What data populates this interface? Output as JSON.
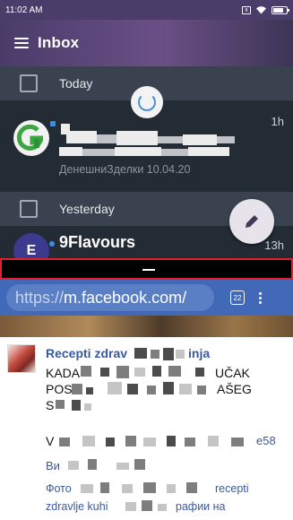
{
  "status_bar": {
    "time": "11:02 AM",
    "sim_label": "x"
  },
  "app_bar": {
    "title": "Inbox"
  },
  "inbox": {
    "sections": [
      {
        "label": "Today"
      },
      {
        "label": "Yesterday"
      }
    ],
    "messages": [
      {
        "avatar_letter": "G",
        "avatar_color": "#4caf50",
        "preview": "ДенешниЗделки 10.04.20",
        "time": "1h",
        "unread": true
      },
      {
        "avatar_letter": "E",
        "avatar_color": "#3b3a8c",
        "sender": "9Flavours",
        "time": "13h",
        "unread": true
      }
    ]
  },
  "browser": {
    "url_scheme": "https://",
    "url_host": "m.facebook.com/",
    "tab_count": "22"
  },
  "post": {
    "author": "Recepti zdrav",
    "author_tail": "inja",
    "line1_start": "KADA",
    "line1_end": "UČAK",
    "line2_start": "POS",
    "line2_end": "AŠEG",
    "line3_start": "S",
    "line4_start": "V",
    "line4_end": "e58",
    "link_start": "Ви",
    "small1_start": "Фото",
    "small1_end": "recepti",
    "small2": "zdravlje kuhi",
    "small2_end": "рафии на"
  },
  "colors": {
    "accent_red": "#e0202a",
    "app_bar": "#4a3c69",
    "browser_bar": "#4169b8",
    "facebook_blue": "#3b5998"
  },
  "icons": [
    "menu-icon",
    "sync-icon",
    "compose-icon",
    "tab-switcher-icon",
    "more-vert-icon",
    "wifi-icon",
    "battery-icon"
  ]
}
